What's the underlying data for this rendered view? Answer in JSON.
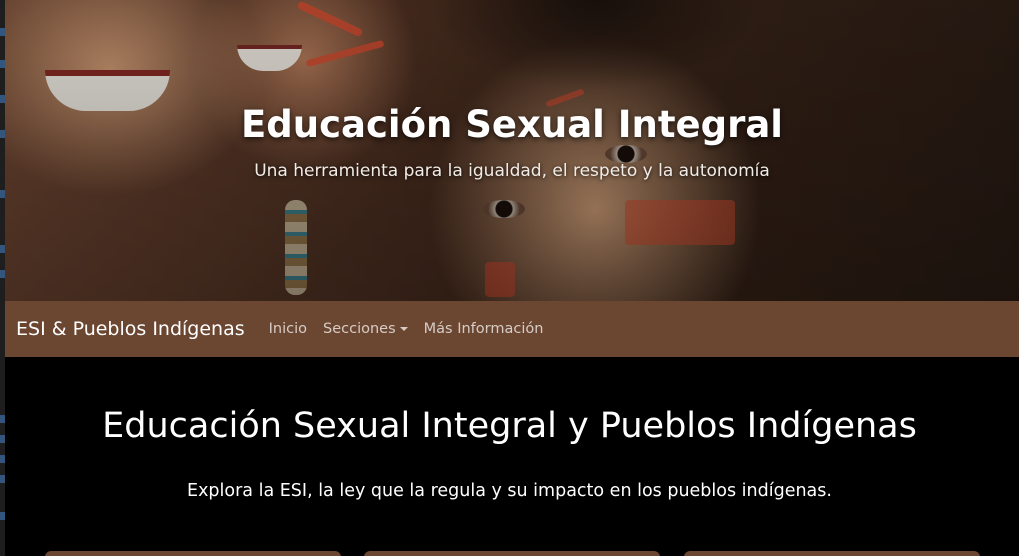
{
  "hero": {
    "title": "Educación Sexual Integral",
    "subtitle": "Una herramienta para la igualdad, el respeto y la autonomía"
  },
  "navbar": {
    "brand": "ESI & Pueblos Indígenas",
    "links": [
      {
        "label": "Inicio"
      },
      {
        "label": "Secciones",
        "dropdown": true
      },
      {
        "label": "Más Información"
      }
    ]
  },
  "main": {
    "title": "Educación Sexual Integral y Pueblos Indígenas",
    "lead": "Explora la ESI, la ley que la regula y su impacto en los pueblos indígenas."
  },
  "colors": {
    "navbar_bg": "#6b4631",
    "page_bg": "#000000",
    "text": "#ffffff"
  },
  "icons": {
    "dropdown": "caret-down-icon"
  }
}
